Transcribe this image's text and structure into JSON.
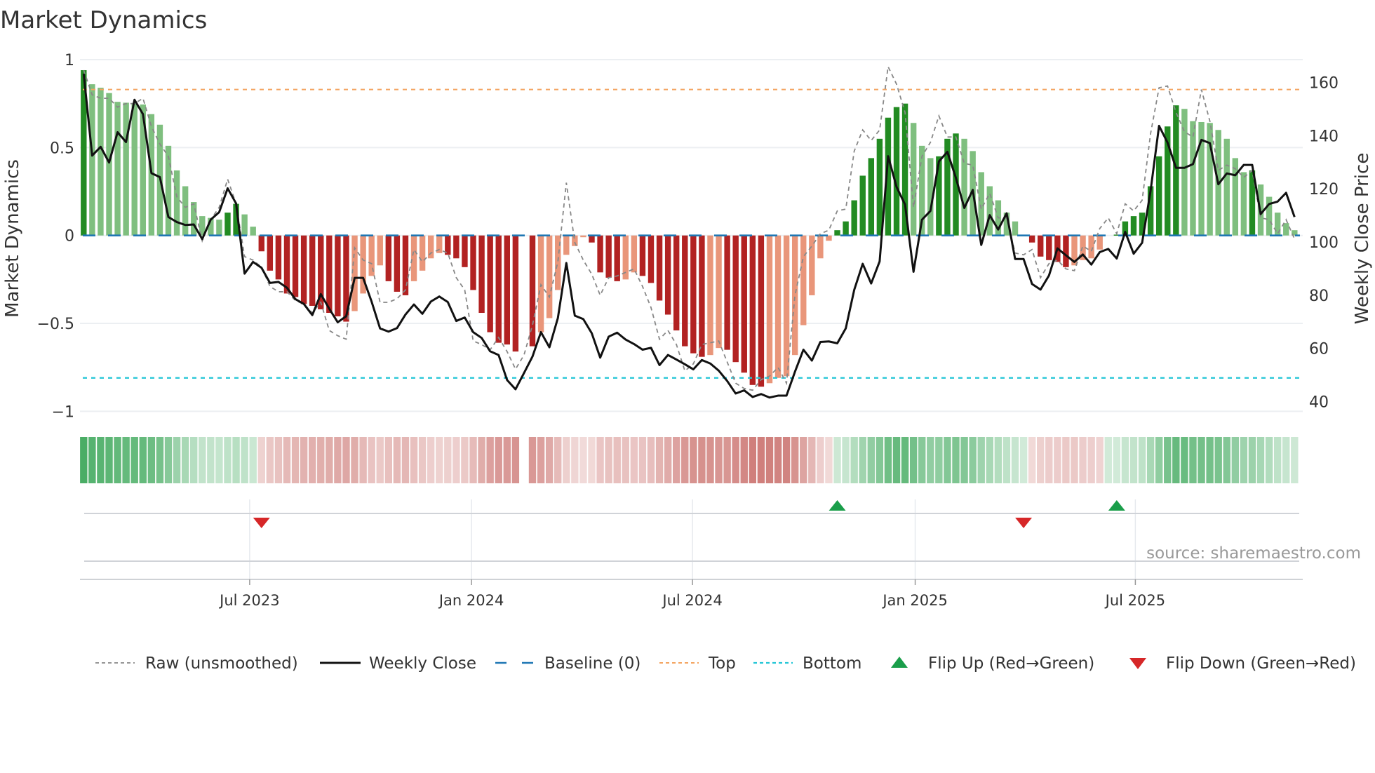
{
  "chart_data": {
    "type": "bar",
    "title": "Market Dynamics",
    "ylabel": "Market Dynamics",
    "y2label": "Weekly Close Price",
    "x_unit": "week index",
    "ylim": [
      -1,
      1
    ],
    "y2lim": [
      36,
      168.6
    ],
    "yticks": [
      {
        "v": 1,
        "label": "1"
      },
      {
        "v": 0.5,
        "label": "0.5"
      },
      {
        "v": 0,
        "label": "0"
      },
      {
        "v": -0.5,
        "label": "−0.5"
      },
      {
        "v": -1,
        "label": "−1"
      }
    ],
    "y2ticks": [
      {
        "v": 160,
        "label": "160"
      },
      {
        "v": 140,
        "label": "140"
      },
      {
        "v": 120,
        "label": "120"
      },
      {
        "v": 100,
        "label": "100"
      },
      {
        "v": 80,
        "label": "80"
      },
      {
        "v": 60,
        "label": "60"
      },
      {
        "v": 40,
        "label": "40"
      }
    ],
    "xticks": [
      {
        "i": 19.6,
        "label": "Jul 2023"
      },
      {
        "i": 45.8,
        "label": "Jan 2024"
      },
      {
        "i": 71.9,
        "label": "Jul 2024"
      },
      {
        "i": 98.2,
        "label": "Jan 2025"
      },
      {
        "i": 124.2,
        "label": "Jul 2025"
      }
    ],
    "top_level": 0.83,
    "bottom_level": -0.81,
    "baseline": 0,
    "grid": true,
    "legend_placement": "bottom",
    "dynamics": [
      0.94,
      0.86,
      0.84,
      0.81,
      0.76,
      0.755,
      0.75,
      0.745,
      0.69,
      0.63,
      0.51,
      0.37,
      0.28,
      0.19,
      0.11,
      0.1,
      0.09,
      0.13,
      0.18,
      0.12,
      0.05,
      -0.09,
      -0.2,
      -0.25,
      -0.33,
      -0.35,
      -0.39,
      -0.4,
      -0.42,
      -0.44,
      -0.46,
      -0.49,
      -0.43,
      -0.33,
      -0.23,
      -0.17,
      -0.26,
      -0.32,
      -0.34,
      -0.26,
      -0.2,
      -0.13,
      -0.1,
      -0.11,
      -0.13,
      -0.18,
      -0.31,
      -0.44,
      -0.55,
      -0.61,
      -0.62,
      -0.66,
      null,
      -0.63,
      -0.55,
      -0.47,
      -0.31,
      -0.11,
      -0.06,
      -0.01,
      -0.04,
      -0.21,
      -0.24,
      -0.26,
      -0.25,
      -0.21,
      -0.23,
      -0.27,
      -0.37,
      -0.45,
      -0.54,
      -0.63,
      -0.67,
      -0.69,
      -0.68,
      -0.64,
      -0.65,
      -0.72,
      -0.78,
      -0.85,
      -0.86,
      -0.84,
      -0.81,
      -0.8,
      -0.68,
      -0.51,
      -0.34,
      -0.13,
      -0.03,
      0.03,
      0.08,
      0.2,
      0.34,
      0.44,
      0.55,
      0.67,
      0.73,
      0.75,
      0.64,
      0.51,
      0.44,
      0.45,
      0.55,
      0.58,
      0.55,
      0.48,
      0.36,
      0.28,
      0.2,
      0.13,
      0.08,
      0,
      -0.04,
      -0.12,
      -0.14,
      -0.15,
      -0.18,
      -0.17,
      -0.14,
      -0.13,
      -0.08,
      0,
      0.005,
      0.08,
      0.11,
      0.13,
      0.28,
      0.45,
      0.62,
      0.74,
      0.72,
      0.65,
      0.645,
      0.64,
      0.6,
      0.55,
      0.44,
      0.36,
      0.37,
      0.29,
      0.22,
      0.13,
      0.07,
      0.03
    ],
    "raw": [
      0.94,
      0.8,
      0.78,
      0.78,
      0.73,
      0.75,
      0.75,
      0.78,
      0.62,
      0.52,
      0.45,
      0.22,
      0.16,
      0.18,
      -0.03,
      0.09,
      0.16,
      0.32,
      0.18,
      -0.12,
      -0.14,
      -0.18,
      -0.29,
      -0.32,
      -0.32,
      -0.37,
      -0.39,
      -0.44,
      -0.38,
      -0.54,
      -0.57,
      -0.59,
      -0.07,
      -0.14,
      -0.16,
      -0.38,
      -0.38,
      -0.36,
      -0.31,
      -0.08,
      -0.15,
      -0.1,
      -0.08,
      -0.1,
      -0.24,
      -0.31,
      -0.6,
      -0.62,
      -0.65,
      -0.58,
      -0.66,
      -0.76,
      -0.68,
      -0.51,
      -0.28,
      -0.35,
      -0.15,
      0.3,
      -0.04,
      -0.14,
      -0.22,
      -0.34,
      -0.24,
      -0.23,
      -0.21,
      -0.19,
      -0.29,
      -0.41,
      -0.59,
      -0.54,
      -0.62,
      -0.77,
      -0.73,
      -0.62,
      -0.61,
      -0.6,
      -0.72,
      -0.84,
      -0.87,
      -0.88,
      -0.82,
      -0.8,
      -0.75,
      -0.84,
      -0.34,
      -0.12,
      -0.06,
      0.01,
      0.03,
      0.14,
      0.15,
      0.48,
      0.6,
      0.54,
      0.6,
      0.96,
      0.86,
      0.7,
      0.16,
      0.45,
      0.53,
      0.68,
      0.56,
      0.56,
      0.41,
      0.4,
      0.15,
      0.24,
      0.1,
      0.1,
      -0.1,
      -0.11,
      -0.08,
      -0.24,
      -0.16,
      -0.14,
      -0.19,
      -0.2,
      -0.06,
      -0.09,
      0.04,
      0.1,
      0.01,
      0.18,
      0.14,
      0.2,
      0.58,
      0.84,
      0.85,
      0.7,
      0.59,
      0.56,
      0.83,
      0.65,
      0.37,
      0.4,
      0.38,
      0.33,
      0.37,
      0.1,
      0.09,
      0.01,
      0.09,
      -0.02
    ],
    "weekly_close": [
      163.3,
      132.5,
      135.8,
      129.9,
      141.3,
      137.6,
      153.5,
      148.1,
      125.9,
      124.4,
      109.4,
      107.5,
      106.4,
      106.6,
      101.1,
      108.4,
      111.2,
      120.2,
      114.5,
      88.1,
      92.5,
      90.3,
      84.6,
      85.0,
      82.8,
      78.5,
      76.7,
      72.5,
      80.4,
      74.9,
      69.8,
      72.1,
      86.5,
      86.5,
      77.6,
      67.5,
      66.3,
      67.6,
      72.7,
      76.5,
      73.0,
      77.6,
      79.5,
      77.4,
      70.3,
      71.6,
      66.1,
      63.9,
      58.9,
      57.5,
      48.1,
      44.6,
      50.7,
      56.9,
      66.1,
      60.4,
      71.4,
      92.1,
      72.3,
      71.0,
      65.7,
      56.5,
      64.4,
      65.9,
      63.3,
      61.6,
      59.5,
      60.2,
      53.7,
      57.5,
      55.8,
      54.0,
      52.1,
      55.6,
      54.3,
      51.6,
      47.7,
      43.0,
      44.2,
      41.7,
      42.8,
      41.5,
      42.2,
      42.2,
      51.2,
      59.5,
      55.4,
      62.4,
      62.6,
      61.9,
      67.5,
      82.0,
      91.8,
      84.4,
      92.7,
      132.3,
      120.7,
      114.1,
      88.8,
      108.4,
      111.7,
      130.3,
      133.9,
      124.2,
      112.8,
      119.6,
      98.9,
      110.1,
      104.7,
      110.8,
      93.6,
      93.6,
      84.2,
      82.1,
      87.4,
      97.6,
      95.0,
      92.5,
      95.3,
      91.5,
      96.2,
      97.4,
      93.8,
      103.8,
      95.6,
      99.7,
      119.3,
      143.7,
      137.4,
      127.9,
      127.9,
      129.3,
      138.4,
      137.2,
      121.7,
      125.8,
      125.1,
      129.0,
      129.0,
      110.5,
      114.3,
      115.2,
      118.5,
      109.4
    ],
    "flips": [
      {
        "i": 21,
        "dir": "down"
      },
      {
        "i": 89,
        "dir": "up"
      },
      {
        "i": 111,
        "dir": "down"
      },
      {
        "i": 122,
        "dir": "up"
      }
    ],
    "legend": [
      {
        "key": "raw",
        "label": "Raw (unsmoothed)"
      },
      {
        "key": "close",
        "label": "Weekly Close"
      },
      {
        "key": "baseline",
        "label": "Baseline (0)"
      },
      {
        "key": "top",
        "label": "Top"
      },
      {
        "key": "bottom",
        "label": "Bottom"
      },
      {
        "key": "flipup",
        "label": "Flip Up (Red→Green)"
      },
      {
        "key": "flipdown",
        "label": "Flip Down (Green→Red)"
      }
    ],
    "source": "source: sharemaestro.com",
    "colors": {
      "green_strong": "#228b22",
      "green_weak": "#7fbf7f",
      "red_strong": "#b22222",
      "red_weak": "#e9967a",
      "baseline": "#1f77b4",
      "top": "#f4a460",
      "bottom": "#22c5d6",
      "raw": "#888888",
      "close": "#111111",
      "flip_up": "#1a9e4a",
      "flip_down": "#d62728",
      "grid": "#eceff2"
    }
  }
}
